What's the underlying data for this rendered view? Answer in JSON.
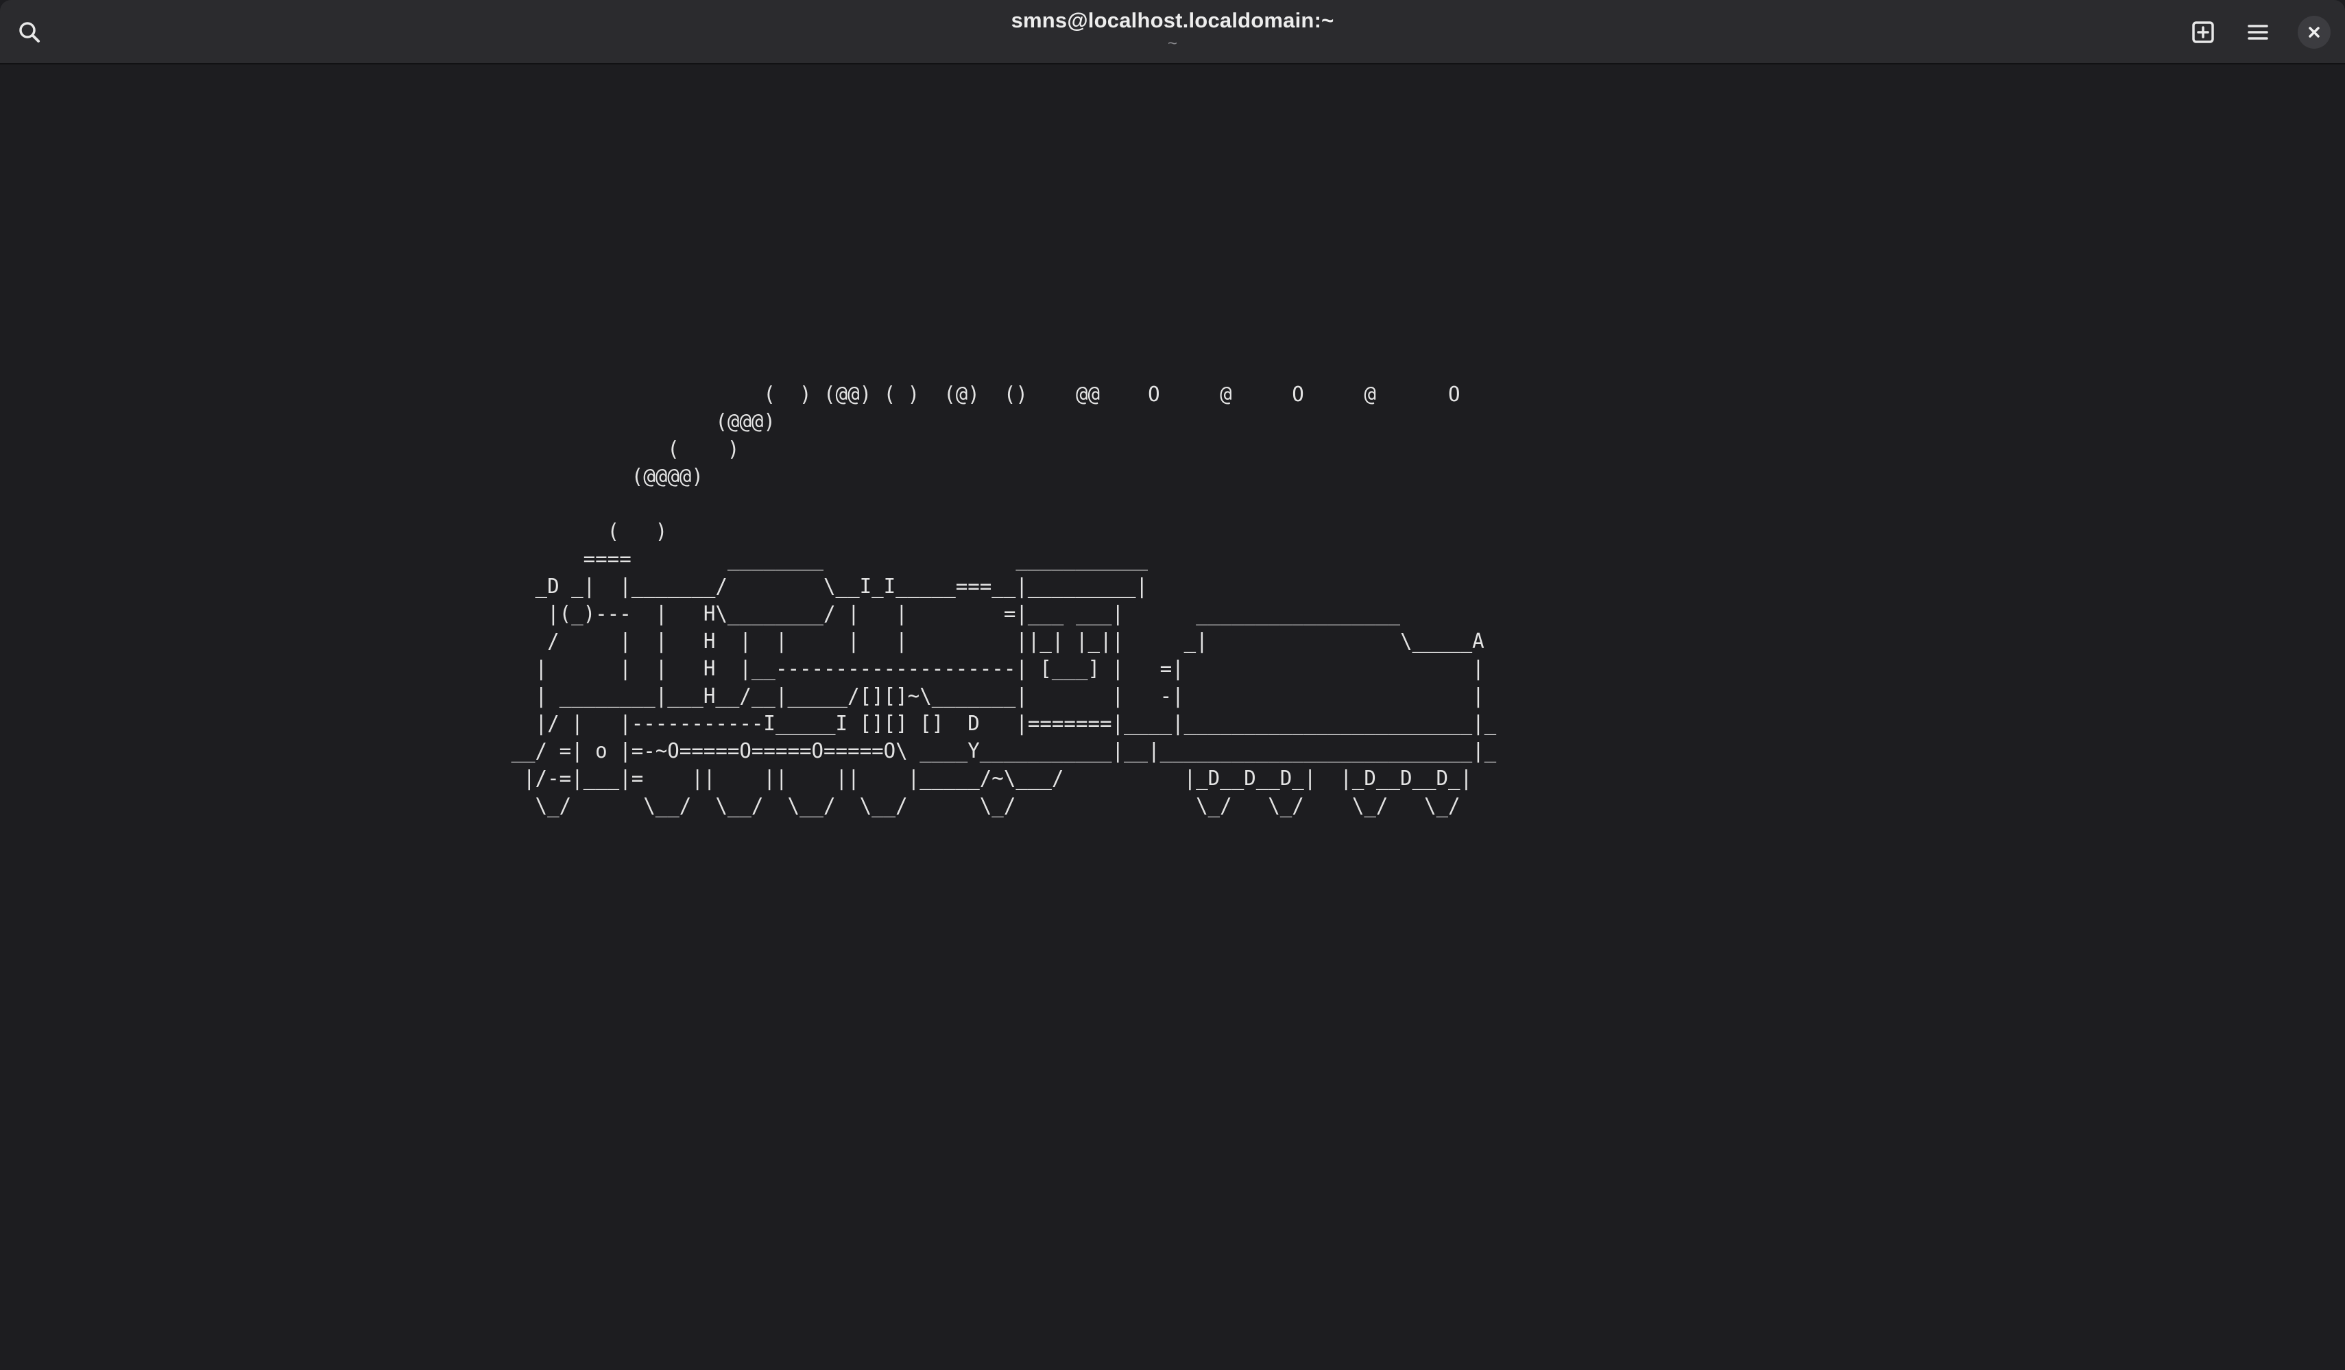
{
  "window": {
    "title": "smns@localhost.localdomain:~",
    "subtitle": "~"
  },
  "header_icons": {
    "search": "search-icon",
    "new_tab": "new-tab-icon",
    "menu": "hamburger-menu-icon",
    "close": "close-icon"
  },
  "terminal": {
    "lines": [
      "                      (  ) (@@) ( )  (@)  ()    @@    O     @     O     @      O",
      "                  (@@@)",
      "              (    )",
      "           (@@@@)",
      "",
      "         (   )",
      "       ====        ________                ___________",
      "   _D _|  |_______/        \\__I_I_____===__|_________|",
      "    |(_)---  |   H\\________/ |   |        =|___ ___|      _________________",
      "    /     |  |   H  |  |     |   |         ||_| |_||     _|                \\_____A",
      "   |      |  |   H  |__--------------------| [___] |   =|                        |",
      "   | ________|___H__/__|_____/[][]~\\_______|       |   -|                        |",
      "   |/ |   |-----------I_____I [][] []  D   |=======|____|________________________|_",
      " __/ =| o |=-~O=====O=====O=====O\\ ____Y___________|__|__________________________|_",
      "  |/-=|___|=    ||    ||    ||    |_____/~\\___/          |_D__D__D_|  |_D__D__D_|",
      "   \\_/      \\__/  \\__/  \\__/  \\__/      \\_/               \\_/   \\_/    \\_/   \\_/"
    ]
  }
}
